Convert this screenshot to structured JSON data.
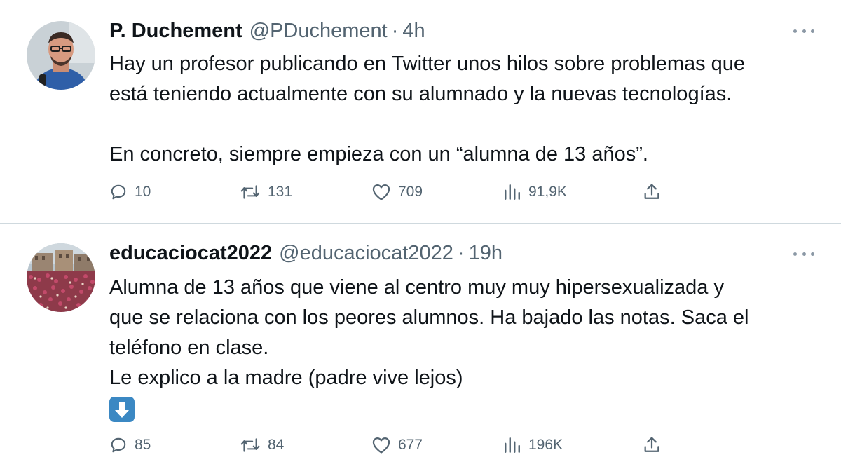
{
  "tweets": [
    {
      "name": "P. Duchement",
      "handle": "@PDuchement",
      "separator": "·",
      "time": "4h",
      "lines": [
        "Hay un profesor publicando en Twitter unos hilos sobre problemas que",
        "está teniendo actualmente con su alumnado y la nuevas tecnologías.",
        "",
        "En concreto, siempre empieza con un “alumna de 13 años”."
      ],
      "stats": {
        "replies": "10",
        "retweets": "131",
        "likes": "709",
        "views": "91,9K"
      }
    },
    {
      "name": "educaciocat2022",
      "handle": "@educaciocat2022",
      "separator": "·",
      "time": "19h",
      "lines": [
        "Alumna de 13 años que viene al centro muy muy hipersexualizada y",
        "que se relaciona con los peores alumnos. Ha bajado las notas. Saca el",
        "teléfono en clase.",
        "Le explico a la madre (padre vive lejos)"
      ],
      "emoji": "down-arrow-emoji",
      "stats": {
        "replies": "85",
        "retweets": "84",
        "likes": "677",
        "views": "196K"
      }
    }
  ],
  "colors": {
    "text": "#0f1419",
    "secondary": "#536471",
    "divider": "#cfd9de",
    "emoji_bg": "#3b88c3"
  },
  "icons": {
    "reply": "reply-icon",
    "retweet": "retweet-icon",
    "like": "like-icon",
    "views": "views-icon",
    "share": "share-icon",
    "more": "more-icon"
  }
}
